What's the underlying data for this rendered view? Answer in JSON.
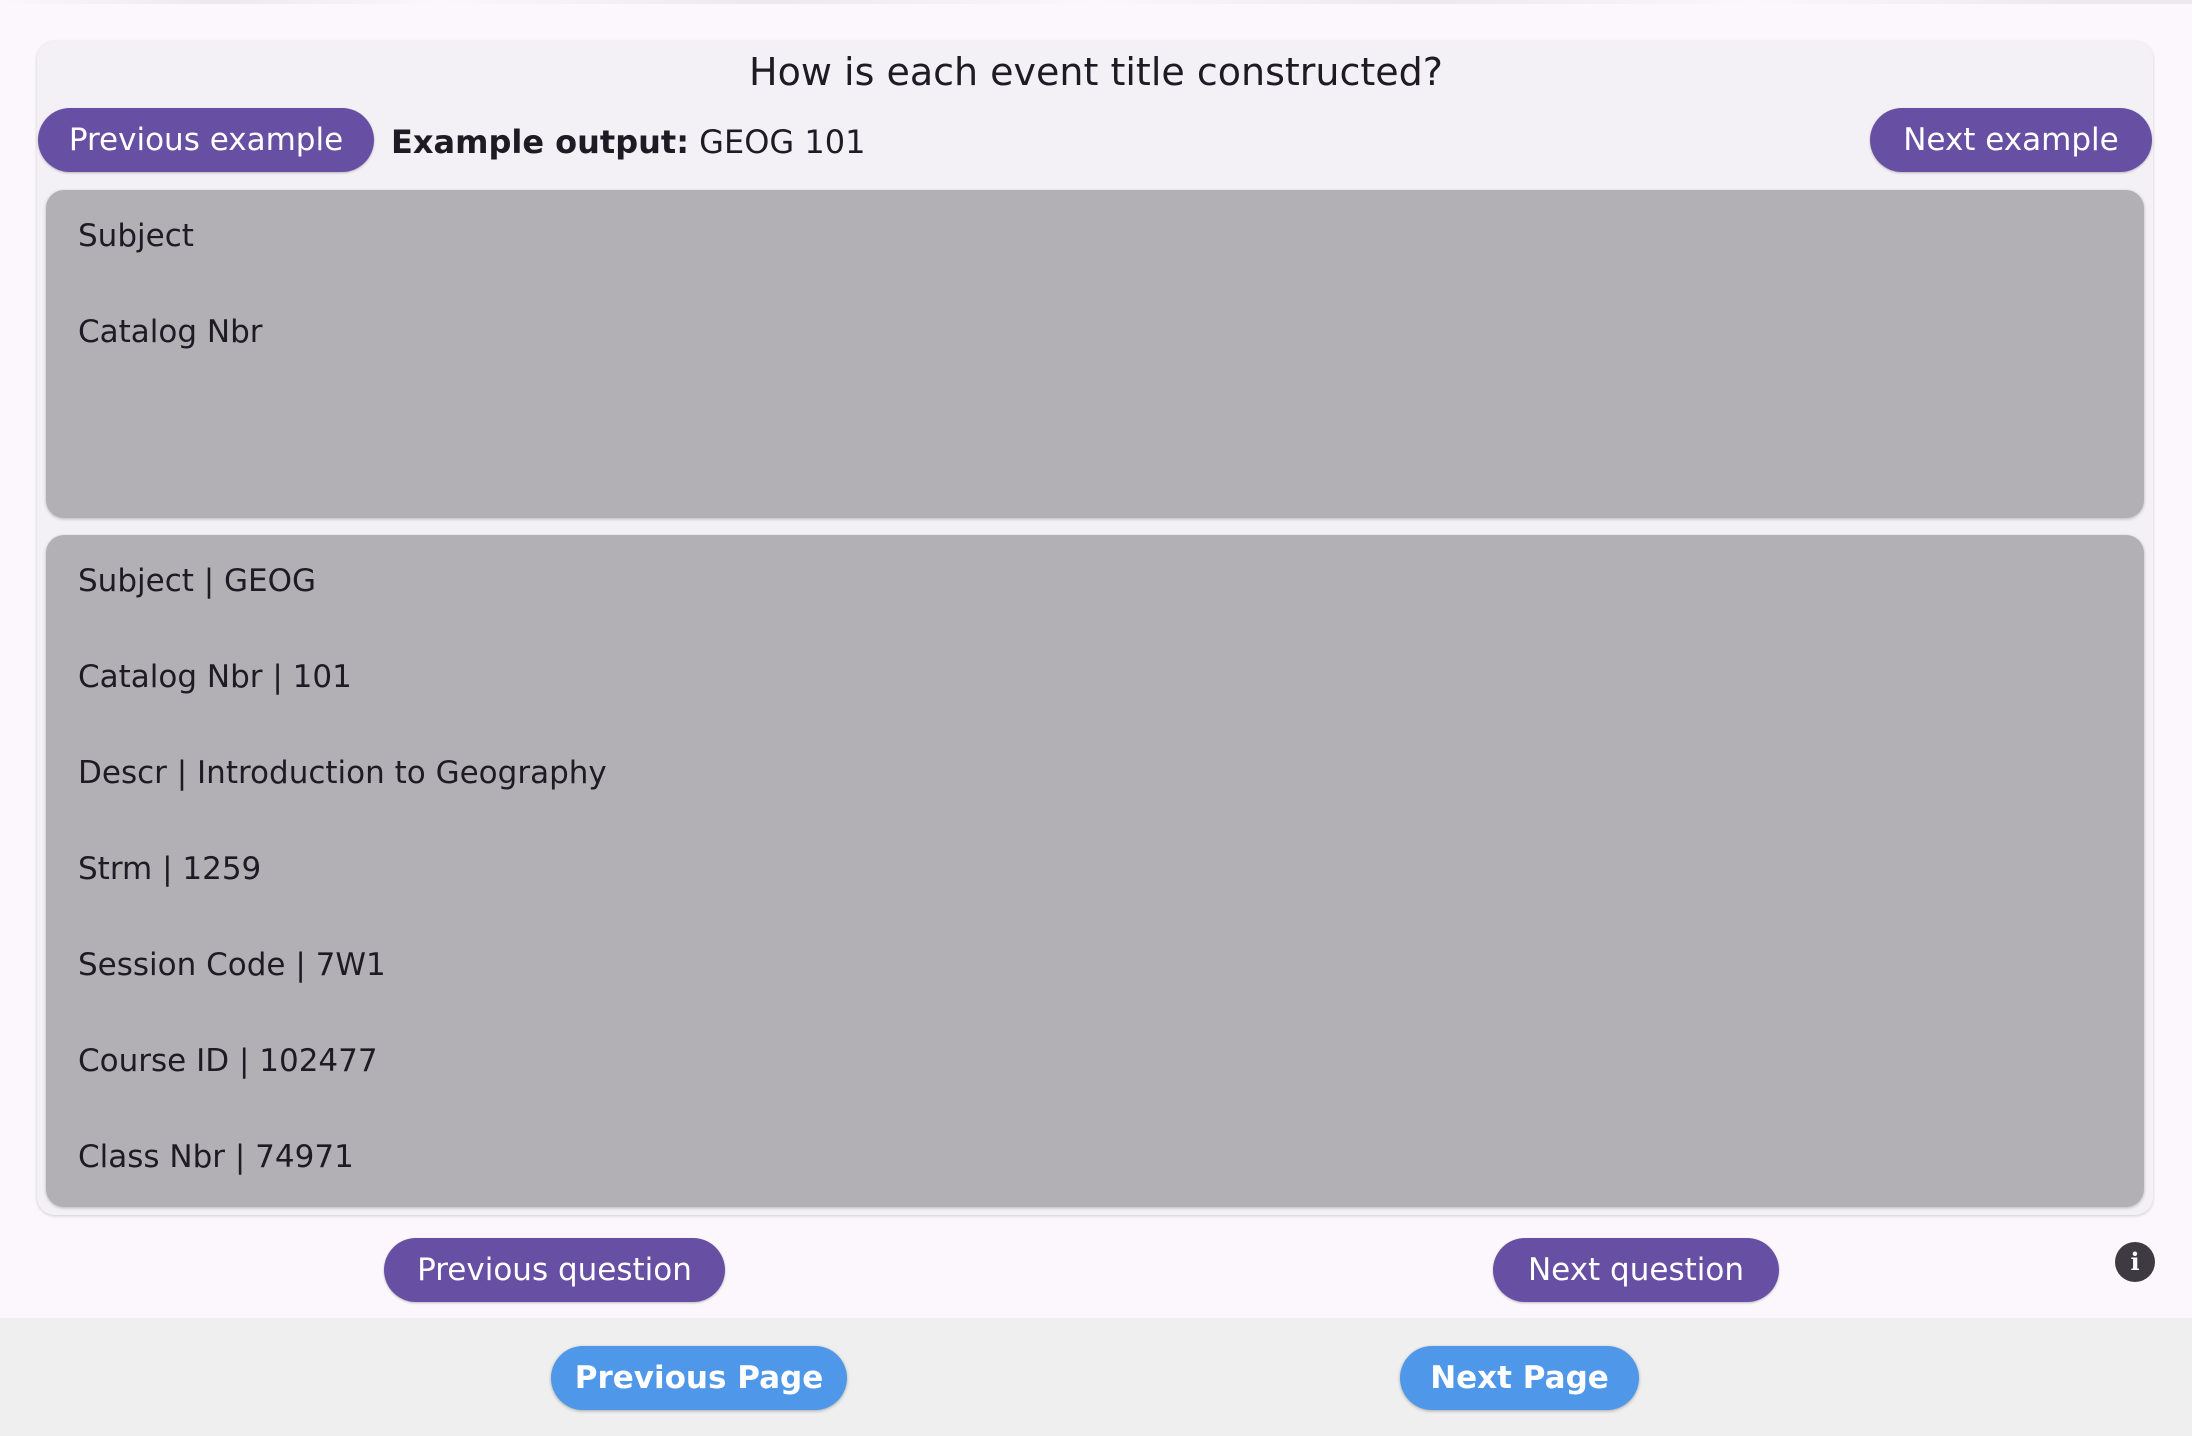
{
  "question": {
    "title": "How is each event title constructed?"
  },
  "example": {
    "prev_label": "Previous example",
    "next_label": "Next example",
    "output_label": "Example output:",
    "output_value": "GEOG 101"
  },
  "selected_fields": [
    "Subject",
    "Catalog Nbr"
  ],
  "available_fields": [
    "Subject | GEOG",
    "Catalog Nbr | 101",
    "Descr | Introduction to Geography",
    "Strm | 1259",
    "Session Code | 7W1",
    "Course ID | 102477",
    "Class Nbr | 74971"
  ],
  "nav": {
    "prev_question": "Previous question",
    "next_question": "Next question",
    "info_icon": "i"
  },
  "footer": {
    "prev_page": "Previous Page",
    "next_page": "Next Page"
  },
  "colors": {
    "primary": "#6750a4",
    "page_button": "#4f97e9",
    "panel": "#b2b0b5"
  }
}
